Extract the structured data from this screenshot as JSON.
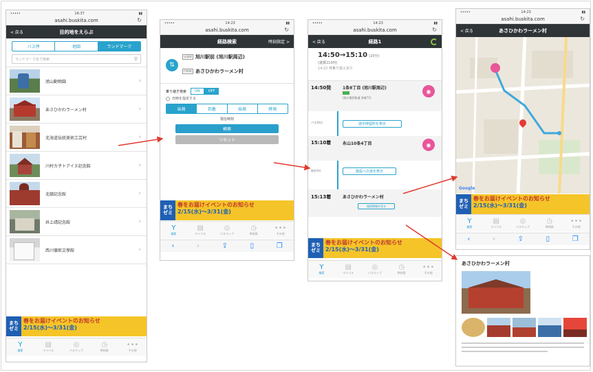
{
  "colors": {
    "accent": "#29a3cc",
    "navbar": "#2f3437",
    "arrow": "#e03a2f",
    "banner_bg": "#f5c428",
    "banner_logo": "#1f5fb4"
  },
  "common": {
    "url": "asahi.buskita.com",
    "banner": {
      "logo_top": "まち",
      "logo_bottom": "ゼミ",
      "line1": "春をお届けイベントのお知らせ",
      "line2": "2/15(水)〜3/31(金)"
    },
    "tabs": [
      {
        "icon": "Y",
        "label": "検索"
      },
      {
        "icon": "▤",
        "label": "マイバス"
      },
      {
        "icon": "◎",
        "label": "バスマップ"
      },
      {
        "icon": "◷",
        "label": "時刻表"
      },
      {
        "icon": "•••",
        "label": "その他"
      }
    ]
  },
  "screen1": {
    "time": "16:37",
    "title": "目的地をえらぶ",
    "back": "< 戻る",
    "segments": [
      "バス停",
      "地図",
      "ランドマーク"
    ],
    "search_placeholder": "ランドマーク名で検索",
    "items": [
      "旭山動物園",
      "あさひかわラーメン村",
      "北海道伝統美術工芸村",
      "川村カ子トアイヌ記念館",
      "北鎮記念館",
      "井上靖記念館",
      "西川徹郎文學館"
    ]
  },
  "screen2": {
    "time": "14:23",
    "title": "経路検索",
    "right": "時刻指定 >",
    "from_tag": "出発地",
    "from": "旭川駅前 (旭川駅周辺)",
    "to_tag": "目的地",
    "to": "あさひかわラーメン村",
    "transfer_label": "乗り継ぎ検索",
    "toggle_on": "ON",
    "toggle_off": "OFF",
    "date_label": "日時を指定する",
    "modes": [
      "出発",
      "到着",
      "始発",
      "終発"
    ],
    "time_label": "現在時刻",
    "search_btn": "検索",
    "reset_btn": "リセット"
  },
  "screen3": {
    "time": "14:23",
    "title": "経路1",
    "back": "< 戻る",
    "summary_time": "14:50→15:10",
    "summary_sub": "(20分)",
    "summary_fare": "(運賃210円)",
    "summary_note": "14:22 発乗り換えあり",
    "stop1_time": "14:50発",
    "stop1_name": "1条8丁目 (旭川駅周辺)",
    "stop1_line": "[旭川電気軌道 系統72]",
    "bus_label": "バス30分",
    "show_stops_btn": "途中停留所を表示",
    "stop2_time": "15:10着",
    "stop2_name": "永山10条4丁目",
    "walk_label": "徒歩3分",
    "show_route_btn": "施設への道を表示",
    "stop3_time": "15:13着",
    "stop3_name": "あさひかわラーメン村",
    "detail_btn": "施設情報を見る"
  },
  "screen4": {
    "time": "14:23",
    "back": "< 戻る",
    "title": "あさひかわラーメン村"
  },
  "screen5": {
    "title": "あさひかわラーメン村"
  }
}
